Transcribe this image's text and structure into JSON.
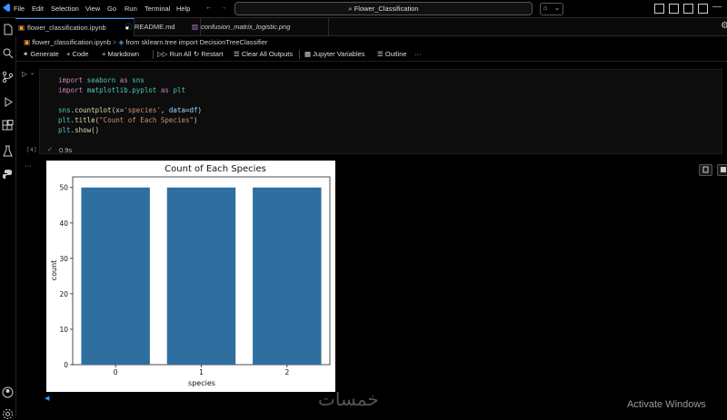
{
  "menu": [
    "File",
    "Edit",
    "Selection",
    "View",
    "Go",
    "Run",
    "Terminal",
    "Help"
  ],
  "search": {
    "value": "Flower_Classification"
  },
  "tabs": [
    {
      "label": "flower_classification.ipynb",
      "modified": true
    },
    {
      "label": "README.md"
    },
    {
      "label": "confusion_matrix_logistic.png"
    }
  ],
  "breadcrumb": {
    "file": "flower_classification.ipynb",
    "symbol": "from sklearn.tree import DecisionTreeClassifier"
  },
  "toolbar": {
    "generate": "Generate",
    "code": "+ Code",
    "markdown": "+ Markdown",
    "run_all": "Run All",
    "restart": "Restart",
    "clear": "Clear All Outputs",
    "variables": "Jupyter Variables",
    "outline": "Outline",
    "more": "···"
  },
  "cell": {
    "exec_count": "[4]",
    "status_time": "0.9s",
    "lines": [
      "import seaborn as sns",
      "import matplotlib.pyplot as plt",
      "",
      "sns.countplot(x='species', data=df)",
      "plt.title(\"Count of Each Species\")",
      "plt.show()"
    ]
  },
  "output_more": "···",
  "chart_data": {
    "type": "bar",
    "title": "Count of Each Species",
    "xlabel": "species",
    "ylabel": "count",
    "categories": [
      "0",
      "1",
      "2"
    ],
    "values": [
      50,
      50,
      50
    ],
    "ylim": [
      0,
      53
    ],
    "yticks": [
      0,
      10,
      20,
      30,
      40,
      50
    ],
    "bar_color": "#2f6f9f"
  },
  "watermark": {
    "line1": "Activate Windows",
    "logo": "خمسات"
  },
  "colors": {
    "accent": "#3794ff",
    "background": "#000000"
  }
}
